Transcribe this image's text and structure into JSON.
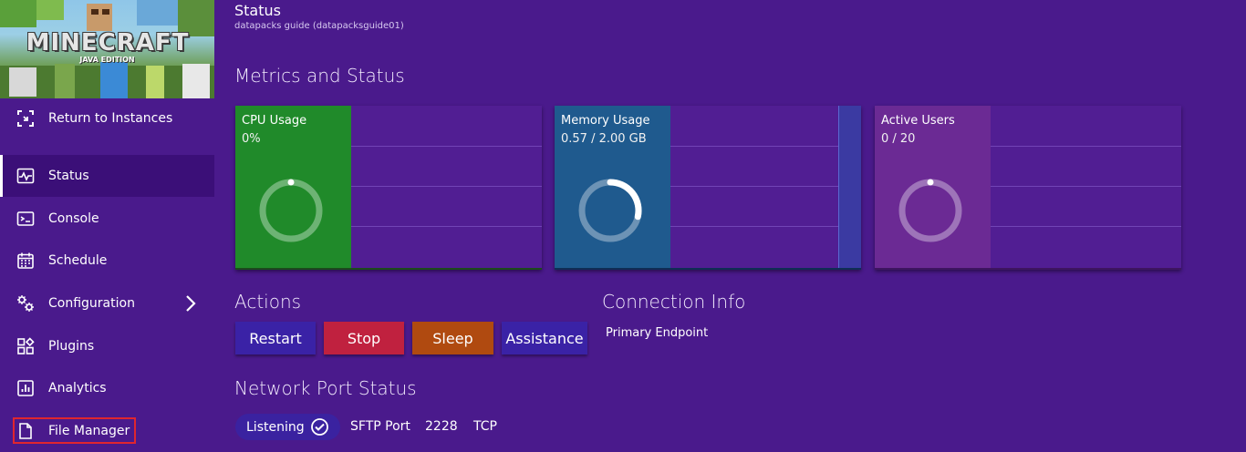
{
  "sidebar": {
    "banner": {
      "logo": "MINECRAFT",
      "edition": "JAVA EDITION"
    },
    "items": [
      {
        "label": "Return to Instances",
        "icon": "return-icon"
      },
      {
        "label": "Status",
        "icon": "pulse-icon",
        "active": true
      },
      {
        "label": "Console",
        "icon": "terminal-icon"
      },
      {
        "label": "Schedule",
        "icon": "calendar-icon"
      },
      {
        "label": "Configuration",
        "icon": "gears-icon",
        "has_submenu": true
      },
      {
        "label": "Plugins",
        "icon": "widgets-icon"
      },
      {
        "label": "Analytics",
        "icon": "chart-icon"
      },
      {
        "label": "File Manager",
        "icon": "file-icon",
        "highlighted": true
      }
    ]
  },
  "header": {
    "title": "Status",
    "subtitle": "datapacks guide (datapacksguide01)"
  },
  "metrics": {
    "heading": "Metrics and Status",
    "cards": [
      {
        "title": "CPU Usage",
        "value": "0%",
        "fraction": 0.0,
        "color": "#208a2a"
      },
      {
        "title": "Memory Usage",
        "value": "0.57 / 2.00 GB",
        "fraction": 0.285,
        "color": "#1f5a8e"
      },
      {
        "title": "Active Users",
        "value": "0 / 20",
        "fraction": 0.0,
        "color": "#6b2a94"
      }
    ]
  },
  "actions": {
    "heading": "Actions",
    "buttons": [
      {
        "label": "Restart",
        "color": "#3a22a6"
      },
      {
        "label": "Stop",
        "color": "#c0213f"
      },
      {
        "label": "Sleep",
        "color": "#b04a10"
      },
      {
        "label": "Assistance",
        "color": "#3a22a6"
      }
    ]
  },
  "connection": {
    "heading": "Connection Info",
    "primary_label": "Primary Endpoint"
  },
  "network": {
    "heading": "Network Port Status",
    "status": "Listening",
    "port_name": "SFTP Port",
    "port_number": "2228",
    "protocol": "TCP"
  }
}
